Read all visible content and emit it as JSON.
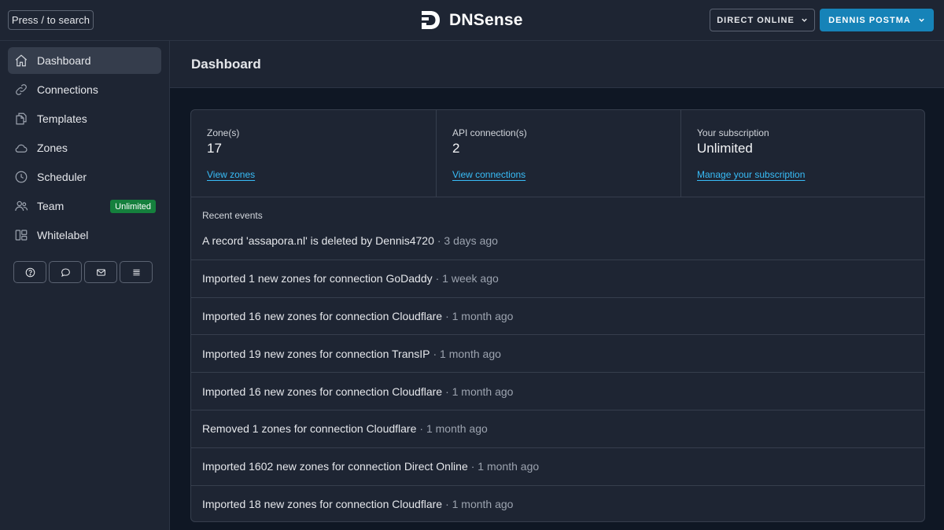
{
  "header": {
    "search_label": "Press / to search",
    "app_name": "DNSense",
    "org_label": "DIRECT ONLINE",
    "user_label": "DENNIS POSTMA",
    "accent_color": "#1683b8"
  },
  "sidebar": {
    "items": [
      {
        "label": "Dashboard",
        "icon": "home-icon",
        "active": true
      },
      {
        "label": "Connections",
        "icon": "link-icon"
      },
      {
        "label": "Templates",
        "icon": "documents-icon"
      },
      {
        "label": "Zones",
        "icon": "cloud-icon"
      },
      {
        "label": "Scheduler",
        "icon": "clock-icon"
      },
      {
        "label": "Team",
        "icon": "users-icon",
        "badge": "Unlimited"
      },
      {
        "label": "Whitelabel",
        "icon": "layout-icon"
      }
    ],
    "tools": [
      "help-icon",
      "chat-icon",
      "mail-icon",
      "list-icon"
    ]
  },
  "page": {
    "title": "Dashboard"
  },
  "stats": [
    {
      "label": "Zone(s)",
      "value": "17",
      "link": "View zones"
    },
    {
      "label": "API connection(s)",
      "value": "2",
      "link": "View connections"
    },
    {
      "label": "Your subscription",
      "value": "Unlimited",
      "link": "Manage your subscription"
    }
  ],
  "events": {
    "title": "Recent events",
    "items": [
      {
        "text": "A record 'assapora.nl' is deleted by Dennis4720",
        "ago": "· 3 days ago"
      },
      {
        "text": "Imported 1 new zones for connection GoDaddy",
        "ago": "· 1 week ago"
      },
      {
        "text": "Imported 16 new zones for connection Cloudflare",
        "ago": "· 1 month ago"
      },
      {
        "text": "Imported 19 new zones for connection TransIP",
        "ago": "· 1 month ago"
      },
      {
        "text": "Imported 16 new zones for connection Cloudflare",
        "ago": "· 1 month ago"
      },
      {
        "text": "Removed 1 zones for connection Cloudflare",
        "ago": "· 1 month ago"
      },
      {
        "text": "Imported 1602 new zones for connection Direct Online",
        "ago": "· 1 month ago"
      },
      {
        "text": "Imported 18 new zones for connection Cloudflare",
        "ago": "· 1 month ago"
      }
    ]
  }
}
